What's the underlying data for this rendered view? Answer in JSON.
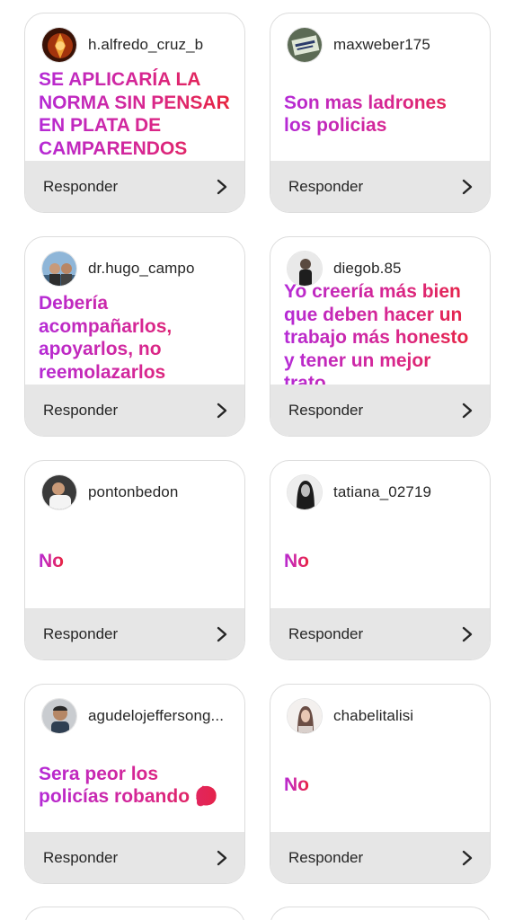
{
  "cards": [
    {
      "username": "h.alfredo_cruz_b",
      "message": "SE APLICARÍA LA NORMA SIN PENSAR EN PLATA DE CAMPARENDOS",
      "reply_label": "Responder",
      "avatar": "avatar-fire-icon"
    },
    {
      "username": "maxweber175",
      "message": "Son mas ladrones los policias",
      "reply_label": "Responder",
      "avatar": "avatar-sign-icon"
    },
    {
      "username": "dr.hugo_campo",
      "message": "Debería acompañarlos, apoyarlos, no reemolazarlos",
      "reply_label": "Responder",
      "avatar": "avatar-group-icon"
    },
    {
      "username": "diegob.85",
      "message": "Yo creería más bien que deben hacer un trabajo más honesto y tener un mejor trato.",
      "reply_label": "Responder",
      "avatar": "avatar-person-dark-icon"
    },
    {
      "username": "pontonbedon",
      "message": "No",
      "reply_label": "Responder",
      "avatar": "avatar-person-white-icon"
    },
    {
      "username": "tatiana_02719",
      "message": "No",
      "reply_label": "Responder",
      "avatar": "avatar-woman-bw-icon"
    },
    {
      "username": "agudelojeffersong...",
      "message": "Sera peor los policías robando 🤔",
      "reply_label": "Responder",
      "avatar": "avatar-man-icon"
    },
    {
      "username": "chabelitalisi",
      "message": "No",
      "reply_label": "Responder",
      "avatar": "avatar-woman-light-icon"
    }
  ],
  "colors": {
    "gradient_start": "#b52ad6",
    "gradient_end": "#e8243a",
    "footer_bg": "#e6e6e6",
    "card_border": "#dcdcdc"
  }
}
